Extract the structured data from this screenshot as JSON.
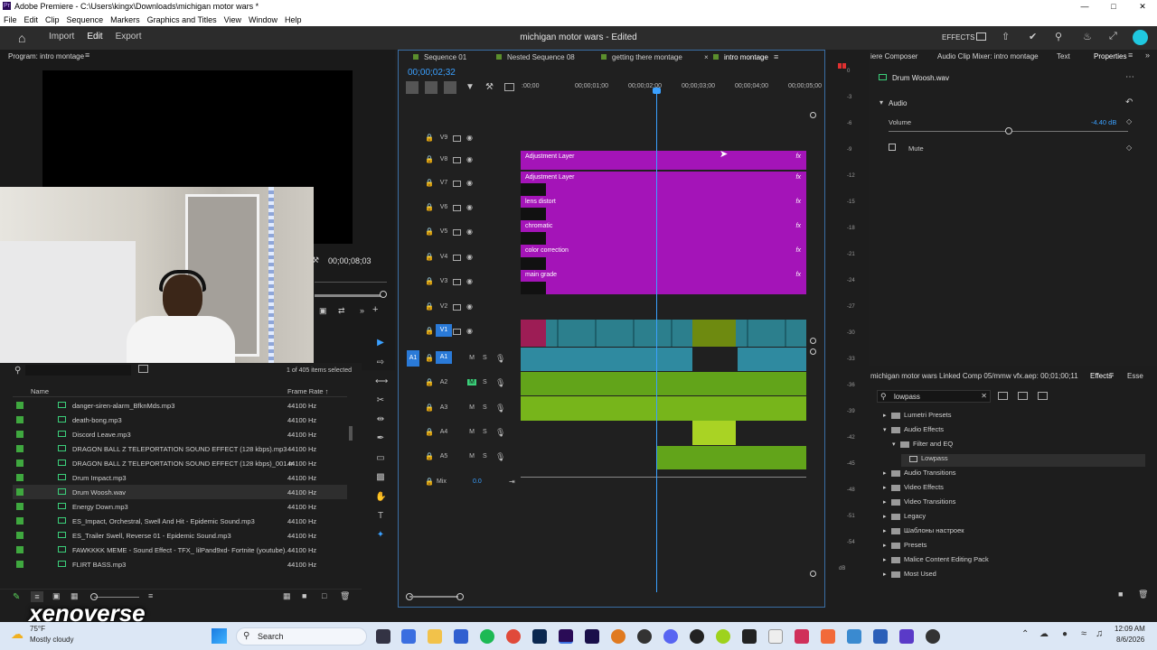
{
  "titlebar": {
    "title": "Adobe Premiere - C:\\Users\\kingx\\Downloads\\michigan motor wars *",
    "app_icon": "Pr"
  },
  "menu": [
    "File",
    "Edit",
    "Clip",
    "Sequence",
    "Markers",
    "Graphics and Titles",
    "View",
    "Window",
    "Help"
  ],
  "header": {
    "nav": [
      "Import",
      "Edit",
      "Export"
    ],
    "active": "Edit",
    "document": "michigan motor wars - Edited",
    "effects_label": "EFFECTS"
  },
  "program": {
    "title": "Program: intro montage",
    "timecode": "00;00;08;03"
  },
  "project": {
    "selected_count": "1 of 405 items selected",
    "columns": {
      "name": "Name",
      "frame_rate": "Frame Rate ↑"
    },
    "items": [
      {
        "name": "danger-siren-alarm_BfknMds.mp3",
        "rate": "44100 Hz"
      },
      {
        "name": "death-bong.mp3",
        "rate": "44100 Hz"
      },
      {
        "name": "Discord Leave.mp3",
        "rate": "44100 Hz"
      },
      {
        "name": "DRAGON BALL Z TELEPORTATION SOUND EFFECT (128  kbps).mp3",
        "rate": "44100 Hz"
      },
      {
        "name": "DRAGON BALL Z TELEPORTATION SOUND EFFECT (128  kbps)_001.m",
        "rate": "44100 Hz"
      },
      {
        "name": "Drum Impact.mp3",
        "rate": "44100 Hz"
      },
      {
        "name": "Drum Woosh.wav",
        "rate": "44100 Hz"
      },
      {
        "name": "Energy Down.mp3",
        "rate": "44100 Hz"
      },
      {
        "name": "ES_Impact, Orchestral, Swell And Hit - Epidemic Sound.mp3",
        "rate": "44100 Hz"
      },
      {
        "name": "ES_Trailer Swell, Reverse 01 - Epidemic Sound.mp3",
        "rate": "44100 Hz"
      },
      {
        "name": "FAWKKKK MEME - Sound Effect - TFX_ lilPand9xd- Fortnite (youtube).",
        "rate": "44100 Hz"
      },
      {
        "name": "FLIRT BASS.mp3",
        "rate": "44100 Hz"
      }
    ]
  },
  "timeline": {
    "tabs": [
      "Sequence 01",
      "Nested Sequence 08",
      "getting there montage",
      "intro montage"
    ],
    "playhead": "00;00;02;32",
    "ruler": [
      ":00;00",
      "00;00;01;00",
      "00;00;02;00",
      "00;00;03;00",
      "00;00;04;00",
      "00;00;05;00"
    ],
    "video_tracks": [
      "V9",
      "V8",
      "V7",
      "V6",
      "V5",
      "V4",
      "V3",
      "V2",
      "V1"
    ],
    "audio_tracks": [
      "A1",
      "A2",
      "A3",
      "A4",
      "A5"
    ],
    "mix_label": "Mix",
    "mix_value": "0.0",
    "clips": [
      "Adjustment Layer",
      "Adjustment Layer",
      "lens distort",
      "chromatic",
      "color correction",
      "main grade"
    ]
  },
  "properties": {
    "tabs": [
      "iere Composer",
      "Audio Clip Mixer: intro montage",
      "Text",
      "Properties"
    ],
    "clip": "Drum Woosh.wav",
    "section": "Audio",
    "volume_label": "Volume",
    "volume_value": "-4.40 dB",
    "volume_level": 0.5,
    "mute_label": "Mute"
  },
  "effects": {
    "title": "michigan motor wars Linked Comp 05/mmw vfx.aep: 00;01;00;11",
    "tab": "Effects",
    "tab2": "Esse",
    "search": "lowpass",
    "tree": [
      "Lumetri Presets",
      "Audio Effects",
      "Filter and EQ",
      "Lowpass",
      "Audio Transitions",
      "Video Effects",
      "Video Transitions",
      "Legacy",
      "Шаблоны настроек",
      "Presets",
      "Malice Content Editing Pack",
      "Most Used"
    ]
  },
  "vu_scale": [
    "0",
    "-3",
    "-6",
    "-9",
    "-12",
    "-15",
    "-18",
    "-21",
    "-24",
    "-27",
    "-30",
    "-33",
    "-36",
    "-39",
    "-42",
    "-45",
    "-48",
    "-51",
    "-54",
    "dB"
  ],
  "overlay": {
    "watermark": "xenoverse"
  },
  "taskbar": {
    "weather_temp": "75°F",
    "weather_desc": "Mostly cloudy",
    "search": "Search",
    "time": "12:09 AM",
    "date": "8/6/2026"
  }
}
